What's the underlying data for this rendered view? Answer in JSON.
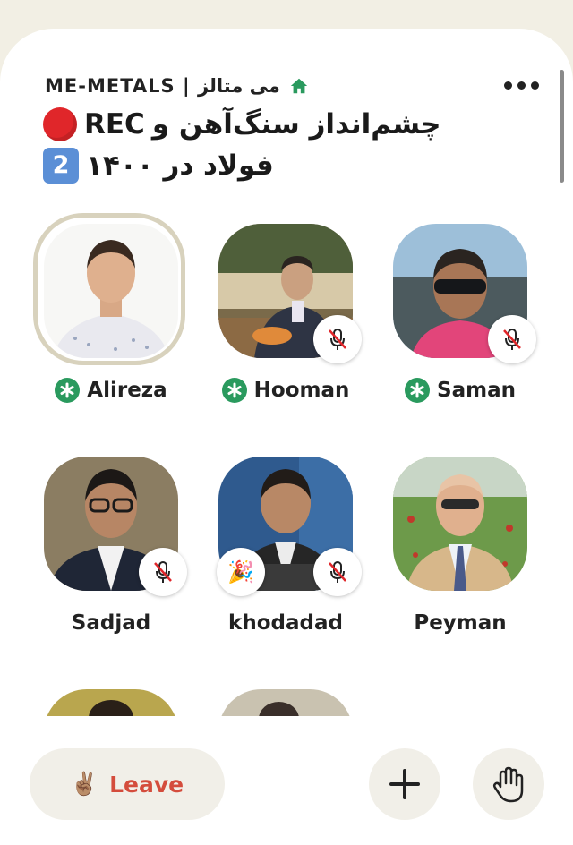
{
  "club": {
    "name": "ME-METALS | می متالز"
  },
  "room": {
    "title_line1_text": "چشم‌انداز سنگ‌آهن و",
    "title_line1_rec": "REC",
    "title_line2_text": "فولاد در ۱۴۰۰",
    "part_number": "2"
  },
  "speakers": [
    {
      "name": "Alireza",
      "moderator": true,
      "speaking": true,
      "muted": false
    },
    {
      "name": "Hooman",
      "moderator": true,
      "speaking": false,
      "muted": true
    },
    {
      "name": "Saman",
      "moderator": true,
      "speaking": false,
      "muted": true
    },
    {
      "name": "Sadjad",
      "moderator": false,
      "speaking": false,
      "muted": true
    },
    {
      "name": "khodadad",
      "moderator": false,
      "speaking": false,
      "muted": true,
      "new_user": true
    },
    {
      "name": "Peyman",
      "moderator": false,
      "speaking": false,
      "muted": false
    }
  ],
  "controls": {
    "leave_label": "Leave",
    "leave_emoji": "✌🏽"
  },
  "colors": {
    "accent_green": "#2a9a5e",
    "leave_red": "#d44c3c",
    "rec_red": "#e0262a",
    "ring": "#d8d2bd"
  },
  "icons": {
    "home": "home-icon",
    "more": "more-icon",
    "add": "plus-icon",
    "raise_hand": "hand-icon",
    "mute": "mic-off-icon",
    "moderator": "asterisk-icon",
    "new_user": "party-popper-icon"
  }
}
